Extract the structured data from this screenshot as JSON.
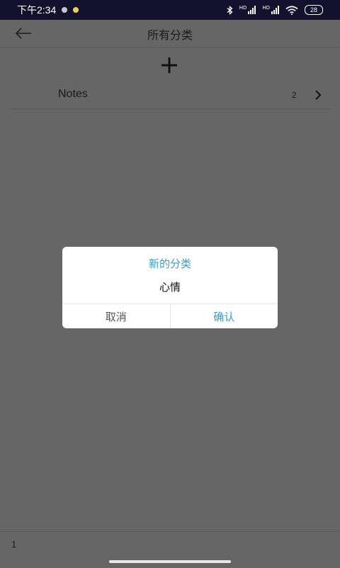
{
  "status_bar": {
    "time": "下午2:34",
    "battery": "28"
  },
  "header": {
    "title": "所有分类"
  },
  "category_list": [
    {
      "name": "Notes",
      "count": "2"
    }
  ],
  "dialog": {
    "title": "新的分类",
    "input_value": "心情",
    "cancel_label": "取消",
    "confirm_label": "确认"
  },
  "footer": {
    "page_number": "1"
  },
  "colors": {
    "accent": "#3a9ad9",
    "status_bar_bg": "#12122e",
    "scrim": "#666666"
  },
  "icons": {
    "back": "arrow-left-icon",
    "add": "plus-icon",
    "chevron": "chevron-right-icon"
  }
}
